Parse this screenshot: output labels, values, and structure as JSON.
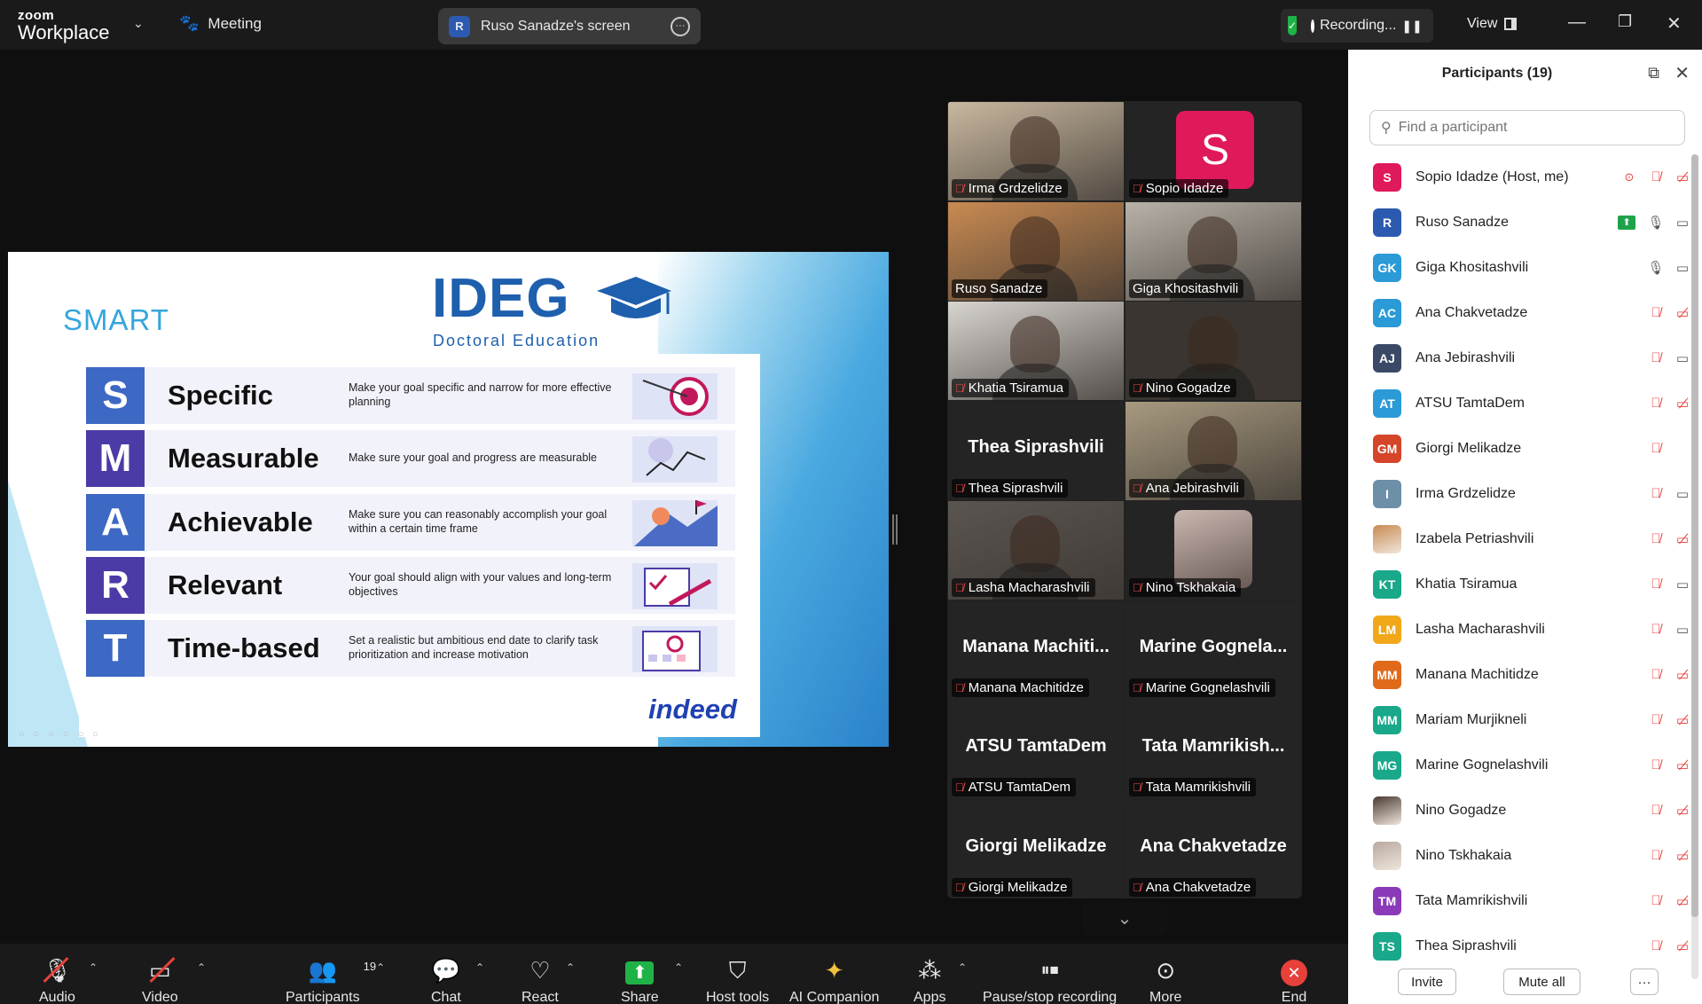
{
  "app": {
    "brand_line1": "zoom",
    "brand_line2": "Workplace",
    "meeting_label": "Meeting",
    "screen_label": "Ruso Sanadze's screen",
    "screen_initial": "R",
    "recording_label": "Recording...",
    "view_label": "View"
  },
  "slide": {
    "title": "SMART",
    "logo_main": "IDEG",
    "logo_sub": "Doctoral Education",
    "brand_footer": "indeed",
    "rows": [
      {
        "letter": "S",
        "word": "Specific",
        "desc": "Make your goal specific and narrow for more effective planning",
        "color": "#3d68c4"
      },
      {
        "letter": "M",
        "word": "Measurable",
        "desc": "Make sure your goal and progress are measurable",
        "color": "#4b3ba6"
      },
      {
        "letter": "A",
        "word": "Achievable",
        "desc": "Make sure you can reasonably accomplish your goal within a certain time frame",
        "color": "#3d68c4"
      },
      {
        "letter": "R",
        "word": "Relevant",
        "desc": "Your goal should align with your values and long-term objectives",
        "color": "#4b3ba6"
      },
      {
        "letter": "T",
        "word": "Time-based",
        "desc": "Set a realistic but ambitious end date to clarify task prioritization and increase motivation",
        "color": "#3d68c4"
      }
    ]
  },
  "gallery": {
    "tiles": [
      {
        "name": "Irma Grdzelidze",
        "muted": true,
        "type": "video",
        "tone": "#c9b8a0"
      },
      {
        "name": "Sopio Idadze",
        "muted": true,
        "type": "avatar",
        "avatar": "S"
      },
      {
        "name": "Ruso Sanadze",
        "muted": false,
        "type": "video",
        "tone": "#c98a52"
      },
      {
        "name": "Giga Khositashvili",
        "muted": false,
        "type": "video",
        "tone": "#b8b2a8",
        "active": true
      },
      {
        "name": "Khatia Tsiramua",
        "muted": true,
        "type": "video",
        "tone": "#d8d4cf"
      },
      {
        "name": "Nino Gogadze",
        "muted": true,
        "type": "video",
        "tone": "#3a3530"
      },
      {
        "name": "Thea Siprashvili",
        "muted": true,
        "type": "name",
        "big": "Thea Siprashvili"
      },
      {
        "name": "Ana Jebirashvili",
        "muted": true,
        "type": "video",
        "tone": "#a89a80"
      },
      {
        "name": "Lasha Macharashvili",
        "muted": true,
        "type": "video",
        "tone": "#5a5550"
      },
      {
        "name": "Nino Tskhakaia",
        "muted": true,
        "type": "photo",
        "tone": "#c9b8b0"
      },
      {
        "name": "Manana Machitidze",
        "muted": true,
        "type": "name",
        "big": "Manana Machiti..."
      },
      {
        "name": "Marine Gognelashvili",
        "muted": true,
        "type": "name",
        "big": "Marine Gognela..."
      },
      {
        "name": "ATSU TamtaDem",
        "muted": true,
        "type": "name",
        "big": "ATSU TamtaDem"
      },
      {
        "name": "Tata Mamrikishvili",
        "muted": true,
        "type": "name",
        "big": "Tata Mamrikish..."
      },
      {
        "name": "Giorgi Melikadze",
        "muted": true,
        "type": "name",
        "big": "Giorgi Melikadze"
      },
      {
        "name": "Ana Chakvetadze",
        "muted": true,
        "type": "name",
        "big": "Ana Chakvetadze"
      }
    ]
  },
  "participants": {
    "title": "Participants (19)",
    "search_placeholder": "Find a participant",
    "invite_label": "Invite",
    "mute_all_label": "Mute all",
    "more_label": "···",
    "list": [
      {
        "initials": "S",
        "name": "Sopio Idadze (Host, me)",
        "color": "#e0195a",
        "mic": "off",
        "cam": "off",
        "rec": true
      },
      {
        "initials": "R",
        "name": "Ruso Sanadze",
        "color": "#2d5ab1",
        "mic": "on",
        "cam": "on",
        "share": true
      },
      {
        "initials": "GK",
        "name": "Giga Khositashvili",
        "color": "#2a9bd6",
        "mic": "on",
        "cam": "on"
      },
      {
        "initials": "AC",
        "name": "Ana Chakvetadze",
        "color": "#2a9bd6",
        "mic": "off",
        "cam": "off"
      },
      {
        "initials": "AJ",
        "name": "Ana Jebirashvili",
        "color": "#3a4a66",
        "mic": "off",
        "cam": "on"
      },
      {
        "initials": "AT",
        "name": "ATSU TamtaDem",
        "color": "#2a9bd6",
        "mic": "off",
        "cam": "off"
      },
      {
        "initials": "GM",
        "name": "Giorgi Melikadze",
        "color": "#d4452a",
        "mic": "off",
        "cam": "none"
      },
      {
        "initials": "I",
        "name": "Irma Grdzelidze",
        "color": "#6d8fa8",
        "mic": "off",
        "cam": "on"
      },
      {
        "initials": "",
        "name": "Izabela Petriashvili",
        "color": "#c98a52",
        "mic": "off",
        "cam": "off",
        "photo": true
      },
      {
        "initials": "KT",
        "name": "Khatia Tsiramua",
        "color": "#19a88a",
        "mic": "off",
        "cam": "on"
      },
      {
        "initials": "LM",
        "name": "Lasha Macharashvili",
        "color": "#f0a81a",
        "mic": "off",
        "cam": "on"
      },
      {
        "initials": "MM",
        "name": "Manana Machitidze",
        "color": "#e06a1a",
        "mic": "off",
        "cam": "off"
      },
      {
        "initials": "MM",
        "name": "Mariam Murjikneli",
        "color": "#19a88a",
        "mic": "off",
        "cam": "off"
      },
      {
        "initials": "MG",
        "name": "Marine Gognelashvili",
        "color": "#19a88a",
        "mic": "off",
        "cam": "off"
      },
      {
        "initials": "",
        "name": "Nino Gogadze",
        "color": "#4a3a30",
        "mic": "off",
        "cam": "off",
        "photo": true
      },
      {
        "initials": "",
        "name": "Nino Tskhakaia",
        "color": "#b8a8a0",
        "mic": "off",
        "cam": "off",
        "photo": true
      },
      {
        "initials": "TM",
        "name": "Tata Mamrikishvili",
        "color": "#8a3ab8",
        "mic": "off",
        "cam": "off"
      },
      {
        "initials": "TS",
        "name": "Thea Siprashvili",
        "color": "#19a88a",
        "mic": "off",
        "cam": "off"
      }
    ]
  },
  "toolbar": {
    "audio": "Audio",
    "video": "Video",
    "participants": "Participants",
    "participants_count": "19",
    "chat": "Chat",
    "react": "React",
    "share": "Share",
    "host_tools": "Host tools",
    "ai_companion": "AI Companion",
    "apps": "Apps",
    "pause_rec": "Pause/stop recording",
    "more": "More",
    "end": "End"
  }
}
